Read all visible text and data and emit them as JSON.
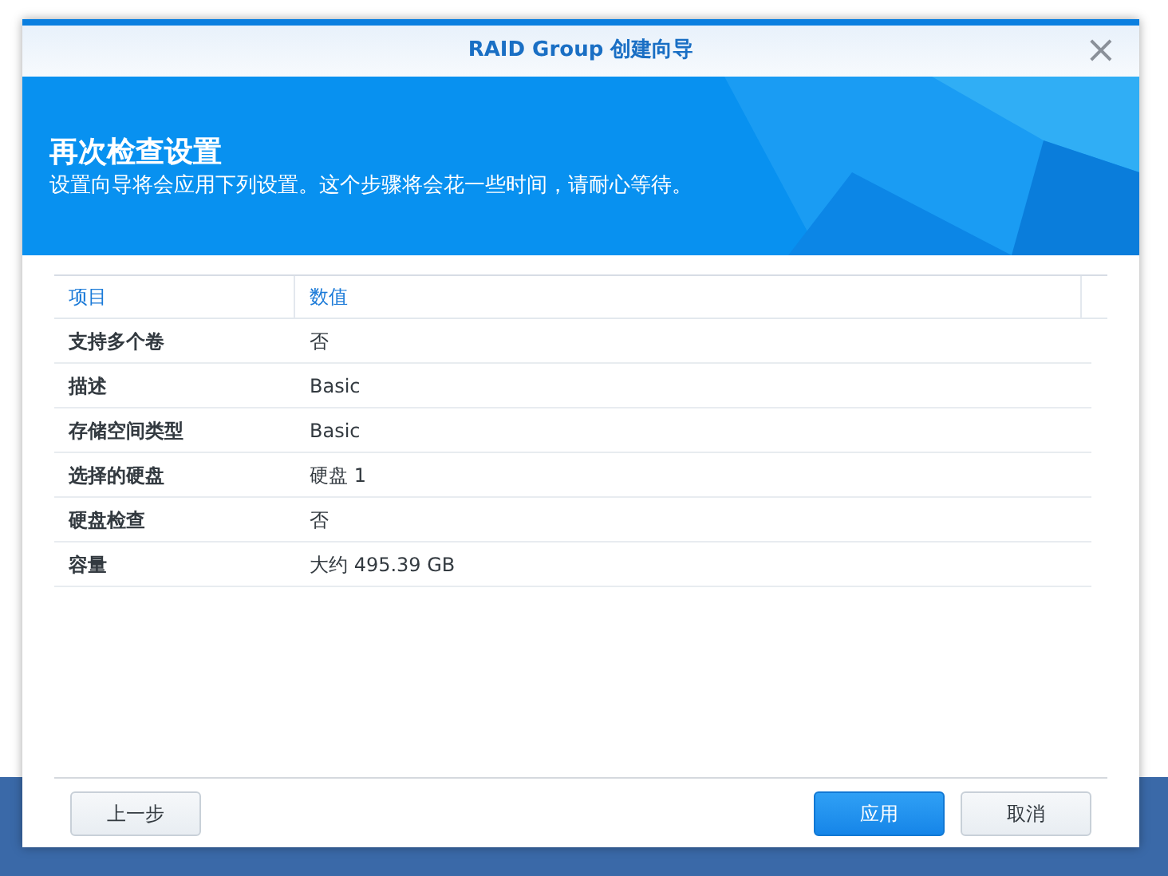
{
  "window": {
    "title": "RAID Group 创建向导",
    "close": "×"
  },
  "banner": {
    "heading": "再次检查设置",
    "description": "设置向导将会应用下列设置。这个步骤将会花一些时间，请耐心等待。"
  },
  "table": {
    "columns": [
      "项目",
      "数值"
    ],
    "rows": [
      [
        "支持多个卷",
        "否"
      ],
      [
        "描述",
        "Basic"
      ],
      [
        "存储空间类型",
        "Basic"
      ],
      [
        "选择的硬盘",
        "硬盘 1"
      ],
      [
        "硬盘检查",
        "否"
      ],
      [
        "容量",
        "大约 495.39 GB"
      ]
    ]
  },
  "buttons": [
    {
      "label": "上一步",
      "kind": "secondary"
    },
    {
      "label": "应用",
      "kind": "primary"
    },
    {
      "label": "取消",
      "kind": "secondary"
    }
  ]
}
